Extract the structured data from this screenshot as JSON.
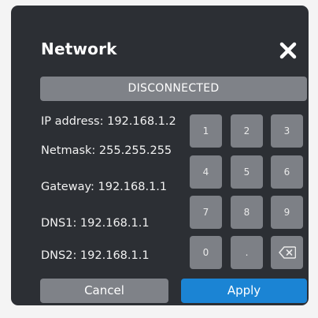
{
  "dialog": {
    "title": "Network",
    "close_icon": "close-icon",
    "status": "DISCONNECTED"
  },
  "info": {
    "ip": "IP address: 192.168.1.2",
    "netmask": "Netmask: 255.255.255",
    "gateway": "Gateway: 192.168.1.1",
    "dns1": "DNS1: 192.168.1.1",
    "dns2": "DNS2: 192.168.1.1"
  },
  "keypad": {
    "k1": "1",
    "k2": "2",
    "k3": "3",
    "k4": "4",
    "k5": "5",
    "k6": "6",
    "k7": "7",
    "k8": "8",
    "k9": "9",
    "k0": "0",
    "dot": ".",
    "backspace_icon": "backspace-icon"
  },
  "buttons": {
    "cancel": "Cancel",
    "apply": "Apply"
  },
  "colors": {
    "dialog_bg": "#2c2f34",
    "key_bg": "#7d8086",
    "accent": "#1b84d4"
  }
}
